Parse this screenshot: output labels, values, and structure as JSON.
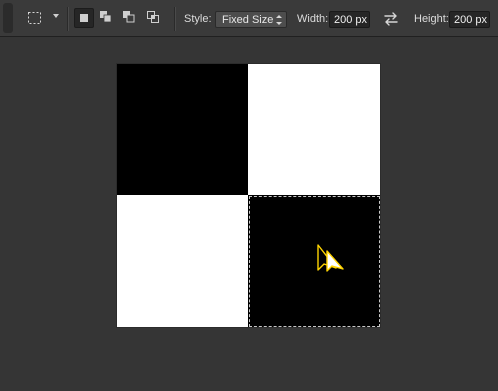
{
  "options_bar": {
    "tool_preset_icon": "rectangular-marquee-icon",
    "selection_modes": [
      {
        "icon": "new-selection-icon",
        "active": true
      },
      {
        "icon": "add-to-selection-icon",
        "active": false
      },
      {
        "icon": "subtract-from-selection-icon",
        "active": false
      },
      {
        "icon": "intersect-selection-icon",
        "active": false
      }
    ],
    "style_label": "Style:",
    "style_value": "Fixed Size",
    "width_label": "Width:",
    "width_value": "200 px",
    "swap_icon": "swap-width-height-icon",
    "height_label": "Height:",
    "height_value": "200 px"
  },
  "canvas": {
    "background_color": "#353535",
    "document": {
      "pattern": "2x2 checkerboard",
      "cells": [
        {
          "position": "top-left",
          "color": "#000000"
        },
        {
          "position": "top-right",
          "color": "#ffffff"
        },
        {
          "position": "bottom-left",
          "color": "#ffffff"
        },
        {
          "position": "bottom-right",
          "color": "#000000"
        }
      ],
      "selection": "bottom-right cell",
      "cursor_icon": "marquee-move-cursor-icon",
      "cursor_color": "#ffd400"
    }
  }
}
